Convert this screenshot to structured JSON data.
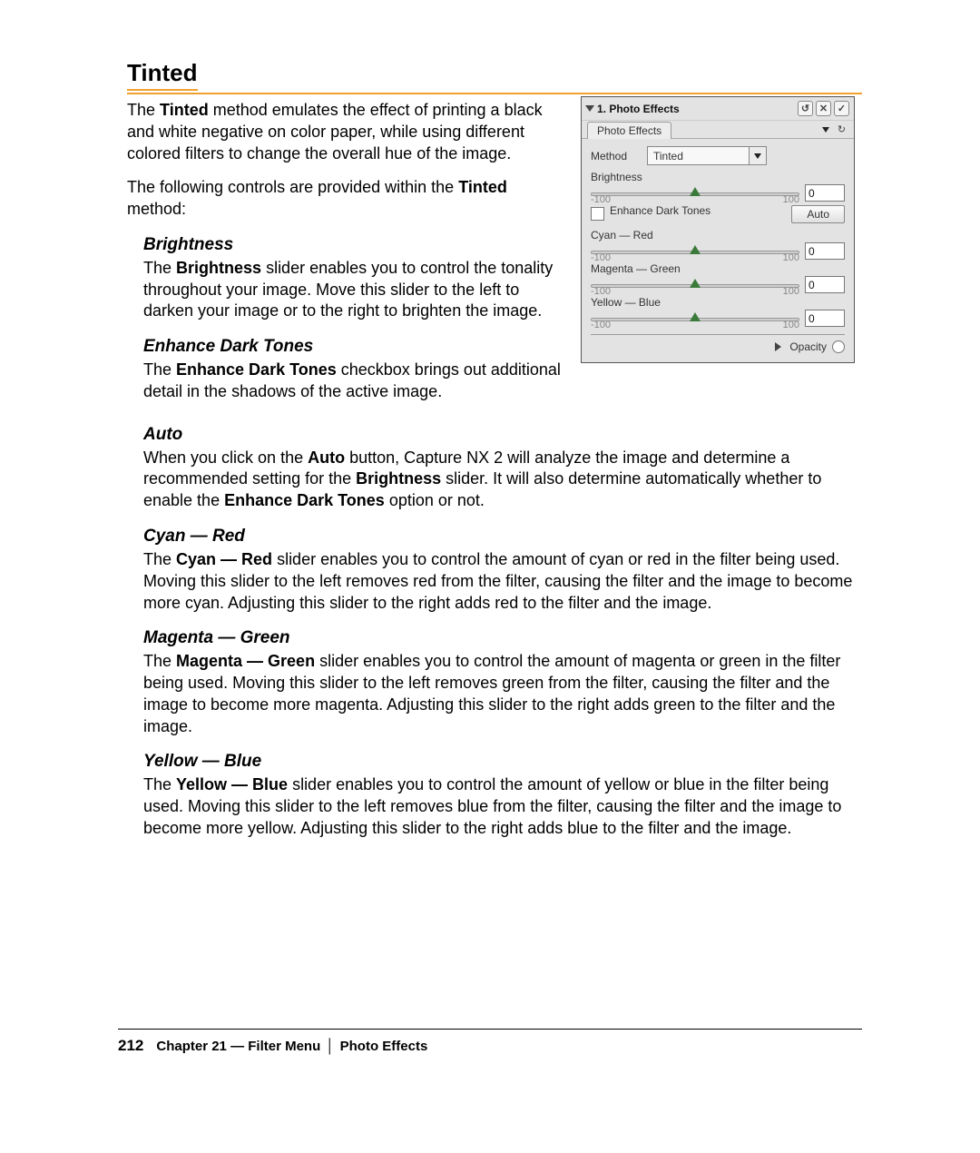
{
  "title": "Tinted",
  "intro_p1a": "The ",
  "intro_p1b": " method emulates the effect of printing a black and white negative on color paper, while using different colored filters to change the overall hue of the image.",
  "intro_p2a": "The following controls are provided within the ",
  "intro_p2b": " method:",
  "bold_tinted": "Tinted",
  "brightness": {
    "h": "Brightness",
    "text_a": "The ",
    "text_b": " slider enables you to control the tonality throughout your image. Move this slider to the left to darken your image or to the right to brighten the image.",
    "bold": "Brightness"
  },
  "edt": {
    "h": "Enhance Dark Tones",
    "text_a": "The ",
    "text_b": " checkbox brings out additional detail in the shadows of the active image.",
    "bold": "Enhance Dark Tones"
  },
  "auto": {
    "h": "Auto",
    "text_a": "When you click on the ",
    "b1": "Auto",
    "text_b": " button, Capture NX 2 will analyze the image and determine a recommended setting for the ",
    "b2": "Brightness",
    "text_c": " slider. It will also determine automatically whether to enable the ",
    "b3": "Enhance Dark Tones",
    "text_d": " option or not."
  },
  "cyan": {
    "h": "Cyan — Red",
    "text_a": "The ",
    "bold": "Cyan — Red",
    "text_b": " slider enables you to control the amount of cyan or red in the filter being used. Moving this slider to the left removes red from the filter, causing the filter and the image to become more cyan. Adjusting this slider to the right adds red to the filter and the image."
  },
  "magenta": {
    "h": "Magenta — Green",
    "text_a": "The ",
    "bold": "Magenta — Green",
    "text_b": " slider enables you to control the amount of magenta or green in the filter being used. Moving this slider to the left removes green from the filter, causing the filter and the image to become more magenta. Adjusting this slider to the right adds green to the filter and the image."
  },
  "yellow": {
    "h": "Yellow — Blue",
    "text_a": "The ",
    "bold": "Yellow — Blue",
    "text_b": " slider enables you to control the amount of yellow or blue in the filter being used. Moving this slider to the left removes blue from the filter, causing the filter and the image to become more yellow. Adjusting this slider to the right adds blue to the filter and the image."
  },
  "panel": {
    "title": "1. Photo Effects",
    "tab": "Photo Effects",
    "method_label": "Method",
    "method_value": "Tinted",
    "brightness_label": "Brightness",
    "edt_label": "Enhance Dark Tones",
    "auto_btn": "Auto",
    "cyan_label": "Cyan — Red",
    "magenta_label": "Magenta — Green",
    "yellow_label": "Yellow — Blue",
    "min": "-100",
    "max": "100",
    "val0": "0",
    "opacity": "Opacity"
  },
  "footer": {
    "page": "212",
    "chapter": "Chapter 21 — Filter Menu",
    "section": "Photo Effects"
  }
}
